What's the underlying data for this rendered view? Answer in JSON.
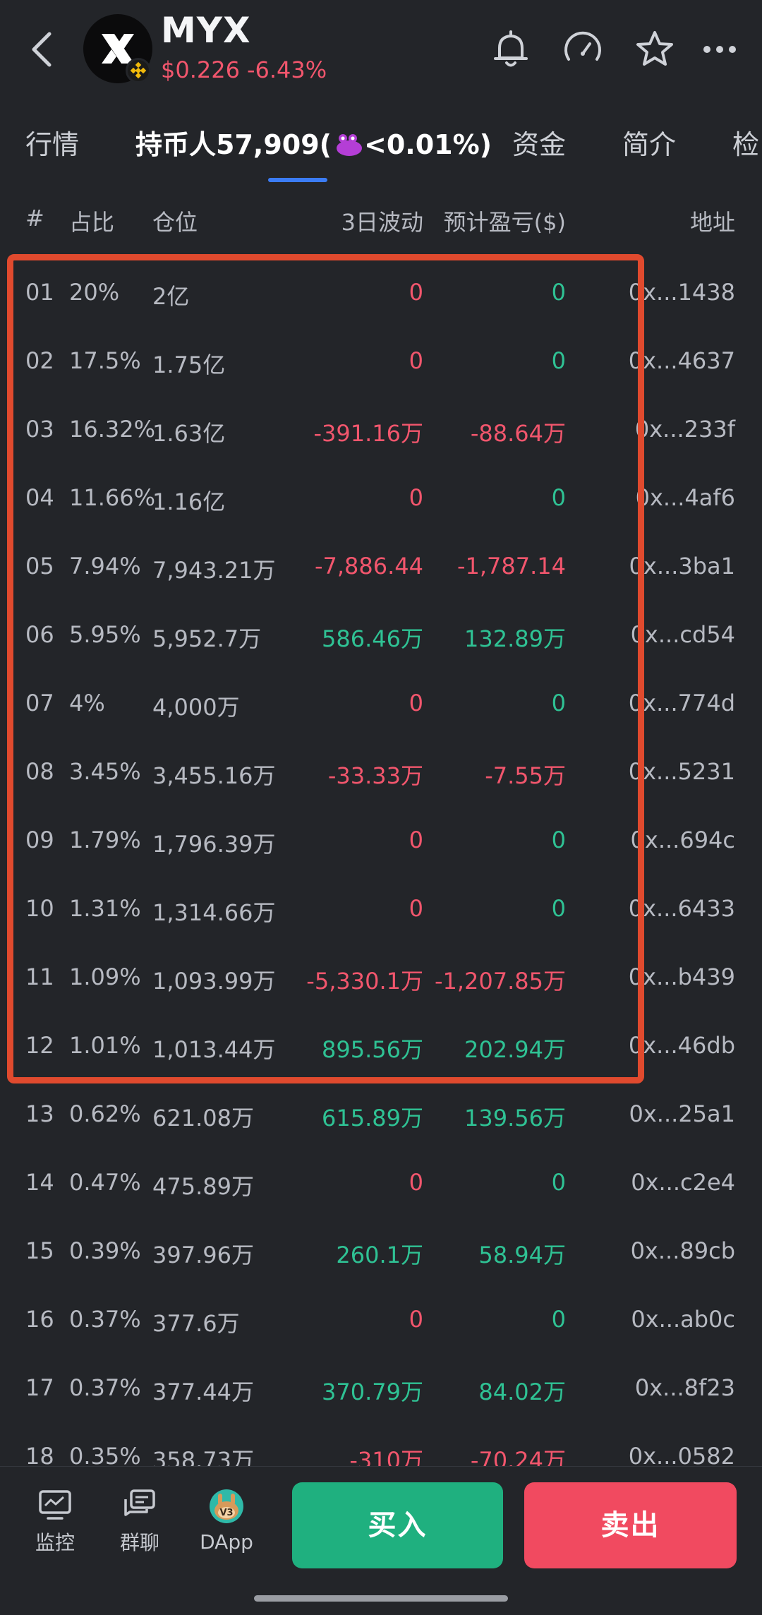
{
  "header": {
    "coin_name": "MYX",
    "price": "$0.226",
    "change": "-6.43%"
  },
  "tabs": [
    {
      "label": "行情"
    },
    {
      "label": "持币人57,909(",
      "suffix": "<0.01%)",
      "active": true
    },
    {
      "label": "资金"
    },
    {
      "label": "简介"
    },
    {
      "label": "检"
    }
  ],
  "table": {
    "headers": [
      "#",
      "占比",
      "仓位",
      "3日波动",
      "预计盈亏($)",
      "地址"
    ],
    "rows": [
      {
        "rank": "01",
        "pct": "20%",
        "pos": "2亿",
        "chg": "0",
        "pnl": "0",
        "addr": "0x...1438"
      },
      {
        "rank": "02",
        "pct": "17.5%",
        "pos": "1.75亿",
        "chg": "0",
        "pnl": "0",
        "addr": "0x...4637"
      },
      {
        "rank": "03",
        "pct": "16.32%",
        "pos": "1.63亿",
        "chg": "-391.16万",
        "pnl": "-88.64万",
        "addr": "0x...233f"
      },
      {
        "rank": "04",
        "pct": "11.66%",
        "pos": "1.16亿",
        "chg": "0",
        "pnl": "0",
        "addr": "0x...4af6"
      },
      {
        "rank": "05",
        "pct": "7.94%",
        "pos": "7,943.21万",
        "chg": "-7,886.44",
        "pnl": "-1,787.14",
        "addr": "0x...3ba1"
      },
      {
        "rank": "06",
        "pct": "5.95%",
        "pos": "5,952.7万",
        "chg": "586.46万",
        "pnl": "132.89万",
        "addr": "0x...cd54"
      },
      {
        "rank": "07",
        "pct": "4%",
        "pos": "4,000万",
        "chg": "0",
        "pnl": "0",
        "addr": "0x...774d"
      },
      {
        "rank": "08",
        "pct": "3.45%",
        "pos": "3,455.16万",
        "chg": "-33.33万",
        "pnl": "-7.55万",
        "addr": "0x...5231"
      },
      {
        "rank": "09",
        "pct": "1.79%",
        "pos": "1,796.39万",
        "chg": "0",
        "pnl": "0",
        "addr": "0x...694c"
      },
      {
        "rank": "10",
        "pct": "1.31%",
        "pos": "1,314.66万",
        "chg": "0",
        "pnl": "0",
        "addr": "0x...6433"
      },
      {
        "rank": "11",
        "pct": "1.09%",
        "pos": "1,093.99万",
        "chg": "-5,330.1万",
        "pnl": "-1,207.85万",
        "addr": "0x...b439"
      },
      {
        "rank": "12",
        "pct": "1.01%",
        "pos": "1,013.44万",
        "chg": "895.56万",
        "pnl": "202.94万",
        "addr": "0x...46db"
      },
      {
        "rank": "13",
        "pct": "0.62%",
        "pos": "621.08万",
        "chg": "615.89万",
        "pnl": "139.56万",
        "addr": "0x...25a1"
      },
      {
        "rank": "14",
        "pct": "0.47%",
        "pos": "475.89万",
        "chg": "0",
        "pnl": "0",
        "addr": "0x...c2e4"
      },
      {
        "rank": "15",
        "pct": "0.39%",
        "pos": "397.96万",
        "chg": "260.1万",
        "pnl": "58.94万",
        "addr": "0x...89cb"
      },
      {
        "rank": "16",
        "pct": "0.37%",
        "pos": "377.6万",
        "chg": "0",
        "pnl": "0",
        "addr": "0x...ab0c"
      },
      {
        "rank": "17",
        "pct": "0.37%",
        "pos": "377.44万",
        "chg": "370.79万",
        "pnl": "84.02万",
        "addr": "0x...8f23"
      },
      {
        "rank": "18",
        "pct": "0.35%",
        "pos": "358.73万",
        "chg": "-310万",
        "pnl": "-70.24万",
        "addr": "0x...0582"
      }
    ]
  },
  "bottom_nav": {
    "monitor": "监控",
    "group_chat": "群聊",
    "dapp": "DApp",
    "dapp_badge": "V3",
    "buy": "买入",
    "sell": "卖出"
  },
  "colors": {
    "positive": "#2fc294",
    "negative": "#f2566d",
    "zero_change": "#f2566d",
    "zero_pnl": "#2fc294",
    "highlight_border": "#e04a2e",
    "tab_underline": "#3b7cf5"
  },
  "icons": [
    "back-icon",
    "bell-icon",
    "gauge-icon",
    "star-icon",
    "more-icon",
    "monitor-icon",
    "chat-icon",
    "dapp-icon"
  ]
}
